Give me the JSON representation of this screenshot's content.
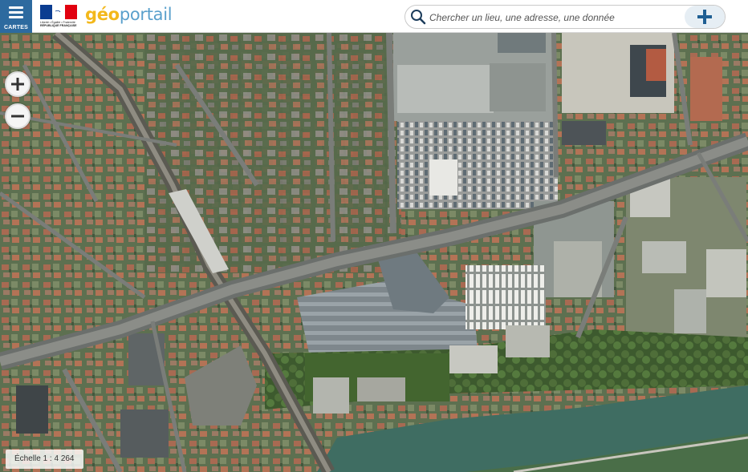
{
  "header": {
    "menu_label": "CARTES",
    "republic_lines": [
      "Liberté • Égalité • Fraternité",
      "RÉPUBLIQUE FRANÇAISE"
    ],
    "brand_part1": "géo",
    "brand_part2": "portail"
  },
  "search": {
    "placeholder": "Chercher un lieu, une adresse, une donnée"
  },
  "map": {
    "scale_text": "Échelle 1 : 4 264",
    "layer": "aerial-photography"
  },
  "icons": {
    "menu": "hamburger-icon",
    "search": "magnifier-icon",
    "add": "plus-icon",
    "zoom_in": "zoom-in-icon",
    "zoom_out": "zoom-out-icon"
  },
  "colors": {
    "menu_bg": "#2d6a9f",
    "brand_yellow": "#f3b81b",
    "brand_blue": "#5aa0cc",
    "plus_icon": "#1f5f93"
  }
}
